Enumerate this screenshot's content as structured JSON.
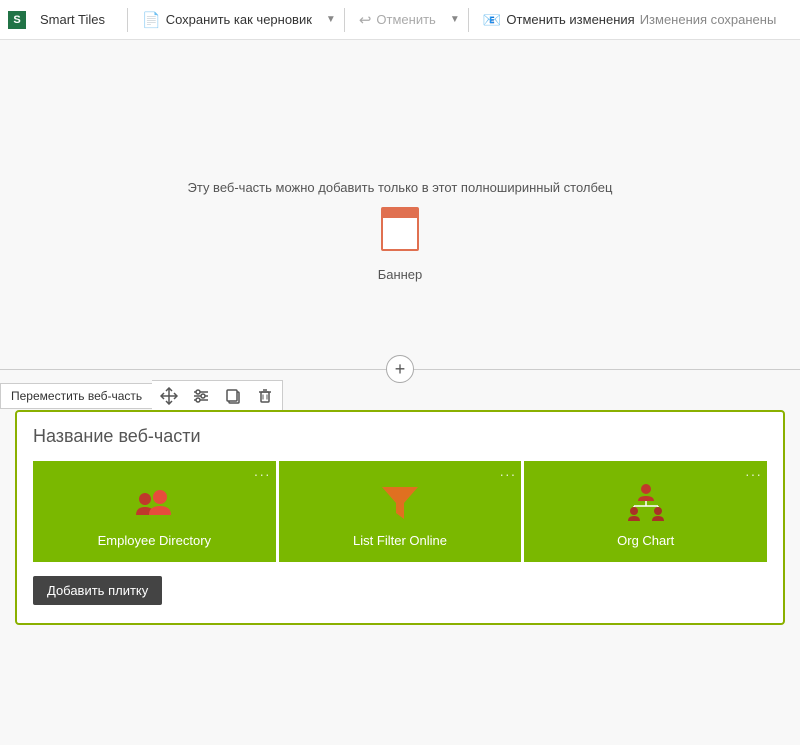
{
  "toolbar": {
    "brand_label": "Smart Tiles",
    "save_draft_label": "Сохранить как черновик",
    "undo_label": "Отменить",
    "cancel_changes_label": "Отменить изменения",
    "saved_label": "Изменения сохранены"
  },
  "main": {
    "fullwidth_notice": "Эту веб-часть можно добавить только в этот полноширинный столбец",
    "banner_label": "Баннер"
  },
  "webpart_toolbar": {
    "move_label": "Переместить веб-часть",
    "move_icon": "⤢",
    "settings_icon": "≡",
    "copy_icon": "⧉",
    "delete_icon": "🗑"
  },
  "webpart": {
    "title": "Название веб-части",
    "add_tile_label": "Добавить плитку",
    "tiles": [
      {
        "label": "Employee Directory",
        "icon_type": "employee-directory"
      },
      {
        "label": "List Filter Online",
        "icon_type": "list-filter"
      },
      {
        "label": "Org Chart",
        "icon_type": "org-chart"
      }
    ]
  }
}
